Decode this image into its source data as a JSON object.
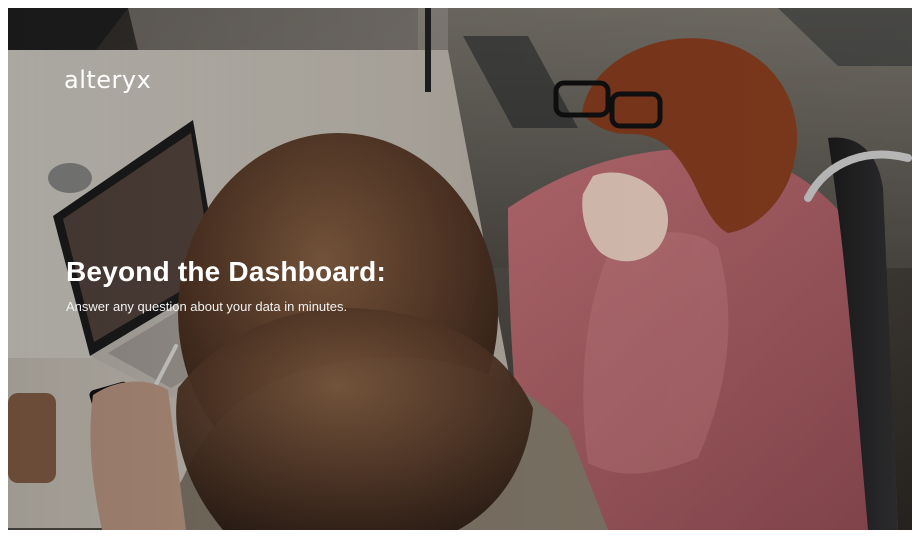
{
  "brand": {
    "logo_text": "alteryx"
  },
  "hero": {
    "title": "Beyond the Dashboard:",
    "subtitle": "Answer any question about your data in minutes.",
    "image_subject": "two-women-reviewing-laptop-photo"
  },
  "colors": {
    "text": "#ffffff",
    "overlay": "#000000",
    "jacket": "#b35f67",
    "hair": "#5b3b2a"
  }
}
